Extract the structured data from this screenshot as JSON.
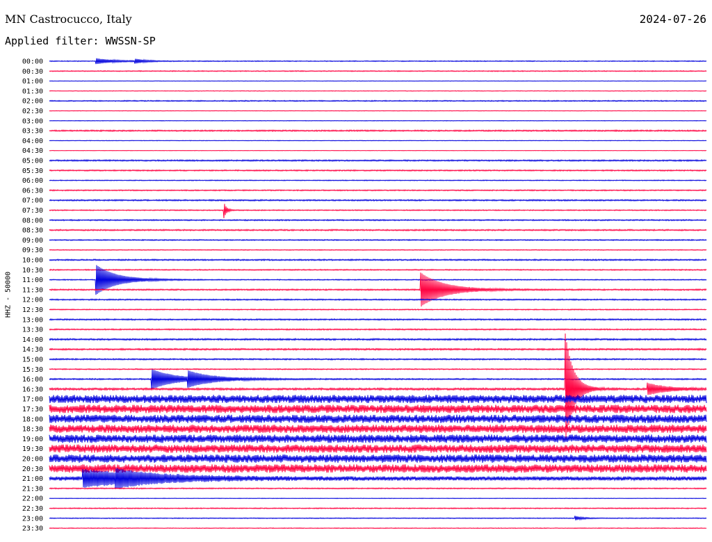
{
  "header": {
    "station": "MN Castrocucco, Italy",
    "date": "2024-07-26",
    "filter": "Applied filter: WWSSN-SP"
  },
  "side_label": "HHZ - 50000",
  "colors": {
    "even": "#0000dd",
    "odd": "#ff0040"
  },
  "chart_data": {
    "type": "line",
    "subtype": "helicorder",
    "title": "MN Castrocucco, Italy",
    "ylabel": "HHZ - 50000",
    "xlabel": "",
    "rows": [
      {
        "label": "00:00",
        "noise": 0.6,
        "events": [
          {
            "x": 0.07,
            "amp": 4,
            "decay": 0.025
          },
          {
            "x": 0.13,
            "amp": 3,
            "decay": 0.015
          }
        ]
      },
      {
        "label": "00:30",
        "noise": 0.7,
        "events": []
      },
      {
        "label": "01:00",
        "noise": 0.3,
        "events": []
      },
      {
        "label": "01:30",
        "noise": 0.4,
        "events": []
      },
      {
        "label": "02:00",
        "noise": 0.8,
        "events": []
      },
      {
        "label": "02:30",
        "noise": 0.4,
        "events": []
      },
      {
        "label": "03:00",
        "noise": 0.4,
        "events": []
      },
      {
        "label": "03:30",
        "noise": 1.0,
        "events": []
      },
      {
        "label": "04:00",
        "noise": 0.4,
        "events": []
      },
      {
        "label": "04:30",
        "noise": 0.3,
        "events": []
      },
      {
        "label": "05:00",
        "noise": 1.0,
        "events": []
      },
      {
        "label": "05:30",
        "noise": 0.9,
        "events": []
      },
      {
        "label": "06:00",
        "noise": 0.6,
        "events": []
      },
      {
        "label": "06:30",
        "noise": 0.8,
        "events": []
      },
      {
        "label": "07:00",
        "noise": 1.0,
        "events": []
      },
      {
        "label": "07:30",
        "noise": 0.7,
        "events": [
          {
            "x": 0.265,
            "amp": 13,
            "decay": 0.004
          }
        ]
      },
      {
        "label": "08:00",
        "noise": 0.9,
        "events": []
      },
      {
        "label": "08:30",
        "noise": 1.0,
        "events": []
      },
      {
        "label": "09:00",
        "noise": 0.8,
        "events": []
      },
      {
        "label": "09:30",
        "noise": 0.6,
        "events": []
      },
      {
        "label": "10:00",
        "noise": 1.0,
        "events": []
      },
      {
        "label": "10:30",
        "noise": 0.8,
        "events": []
      },
      {
        "label": "11:00",
        "noise": 0.7,
        "events": [
          {
            "x": 0.07,
            "amp": 22,
            "decay": 0.03
          }
        ]
      },
      {
        "label": "11:30",
        "noise": 1.0,
        "events": [
          {
            "x": 0.565,
            "amp": 24,
            "decay": 0.035
          }
        ]
      },
      {
        "label": "12:00",
        "noise": 0.9,
        "events": []
      },
      {
        "label": "12:30",
        "noise": 0.7,
        "events": []
      },
      {
        "label": "13:00",
        "noise": 1.0,
        "events": []
      },
      {
        "label": "13:30",
        "noise": 0.9,
        "events": []
      },
      {
        "label": "14:00",
        "noise": 1.2,
        "events": []
      },
      {
        "label": "14:30",
        "noise": 1.2,
        "events": []
      },
      {
        "label": "15:00",
        "noise": 1.0,
        "events": []
      },
      {
        "label": "15:30",
        "noise": 0.8,
        "events": []
      },
      {
        "label": "16:00",
        "noise": 1.0,
        "events": [
          {
            "x": 0.155,
            "amp": 14,
            "decay": 0.035
          },
          {
            "x": 0.21,
            "amp": 9,
            "decay": 0.04
          }
        ]
      },
      {
        "label": "16:30",
        "noise": 1.5,
        "events": [
          {
            "x": 0.785,
            "amp": 80,
            "decay": 0.012
          },
          {
            "x": 0.91,
            "amp": 8,
            "decay": 0.03
          }
        ]
      },
      {
        "label": "17:00",
        "noise": 6.0,
        "events": []
      },
      {
        "label": "17:30",
        "noise": 6.0,
        "events": []
      },
      {
        "label": "18:00",
        "noise": 6.0,
        "events": []
      },
      {
        "label": "18:30",
        "noise": 6.0,
        "events": []
      },
      {
        "label": "19:00",
        "noise": 6.0,
        "events": []
      },
      {
        "label": "19:30",
        "noise": 6.0,
        "events": []
      },
      {
        "label": "20:00",
        "noise": 6.0,
        "events": []
      },
      {
        "label": "20:30",
        "noise": 6.0,
        "events": []
      },
      {
        "label": "21:00",
        "noise": 3.0,
        "events": [
          {
            "x": 0.05,
            "amp": 11,
            "decay": 0.1
          },
          {
            "x": 0.1,
            "amp": 6,
            "decay": 0.05
          }
        ]
      },
      {
        "label": "21:30",
        "noise": 0.8,
        "events": []
      },
      {
        "label": "22:00",
        "noise": 0.4,
        "events": []
      },
      {
        "label": "22:30",
        "noise": 0.7,
        "events": []
      },
      {
        "label": "23:00",
        "noise": 0.6,
        "events": [
          {
            "x": 0.8,
            "amp": 3,
            "decay": 0.01
          }
        ]
      },
      {
        "label": "23:30",
        "noise": 0.5,
        "events": []
      }
    ]
  }
}
